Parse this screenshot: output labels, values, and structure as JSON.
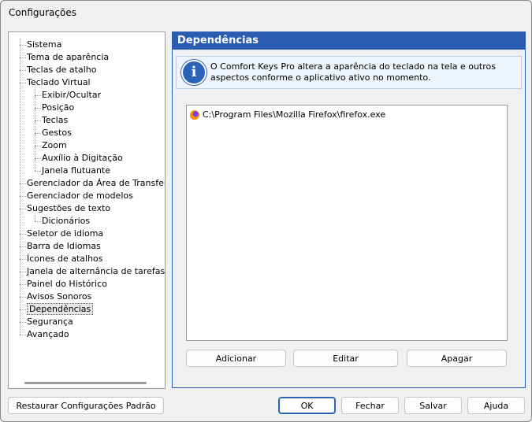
{
  "window": {
    "title": "Configurações"
  },
  "tree": {
    "items": [
      {
        "label": "Sistema",
        "level": 0
      },
      {
        "label": "Tema de aparência",
        "level": 0
      },
      {
        "label": "Teclas de atalho",
        "level": 0
      },
      {
        "label": "Teclado Virtual",
        "level": 0
      },
      {
        "label": "Exibir/Ocultar",
        "level": 1
      },
      {
        "label": "Posição",
        "level": 1
      },
      {
        "label": "Teclas",
        "level": 1
      },
      {
        "label": "Gestos",
        "level": 1
      },
      {
        "label": "Zoom",
        "level": 1
      },
      {
        "label": "Auxílio à Digitação",
        "level": 1
      },
      {
        "label": "Janela flutuante",
        "level": 1
      },
      {
        "label": "Gerenciador da Área de Transferência",
        "level": 0
      },
      {
        "label": "Gerenciador de modelos",
        "level": 0
      },
      {
        "label": "Sugestões de texto",
        "level": 0
      },
      {
        "label": "Dicionários",
        "level": 1
      },
      {
        "label": "Seletor de idioma",
        "level": 0
      },
      {
        "label": "Barra de Idiomas",
        "level": 0
      },
      {
        "label": "Ícones de atalhos",
        "level": 0
      },
      {
        "label": "Janela de alternância de tarefas",
        "level": 0
      },
      {
        "label": "Painel do Histórico",
        "level": 0
      },
      {
        "label": "Avisos Sonoros",
        "level": 0
      },
      {
        "label": "Dependências",
        "level": 0,
        "selected": true
      },
      {
        "label": "Segurança",
        "level": 0
      },
      {
        "label": "Avançado",
        "level": 0
      }
    ]
  },
  "panel": {
    "header": "Dependências",
    "info_icon": "info-icon",
    "info_text": "O Comfort Keys Pro altera a aparência do teclado na tela e outros aspectos conforme o aplicativo ativo no momento.",
    "list_items": [
      {
        "icon": "firefox-icon",
        "path": "C:\\Program Files\\Mozilla Firefox\\firefox.exe"
      }
    ],
    "buttons": {
      "add": "Adicionar",
      "edit": "Editar",
      "delete": "Apagar"
    }
  },
  "footer": {
    "restore": "Restaurar Configurações Padrão",
    "ok": "OK",
    "close": "Fechar",
    "save": "Salvar",
    "help": "Ajuda"
  }
}
